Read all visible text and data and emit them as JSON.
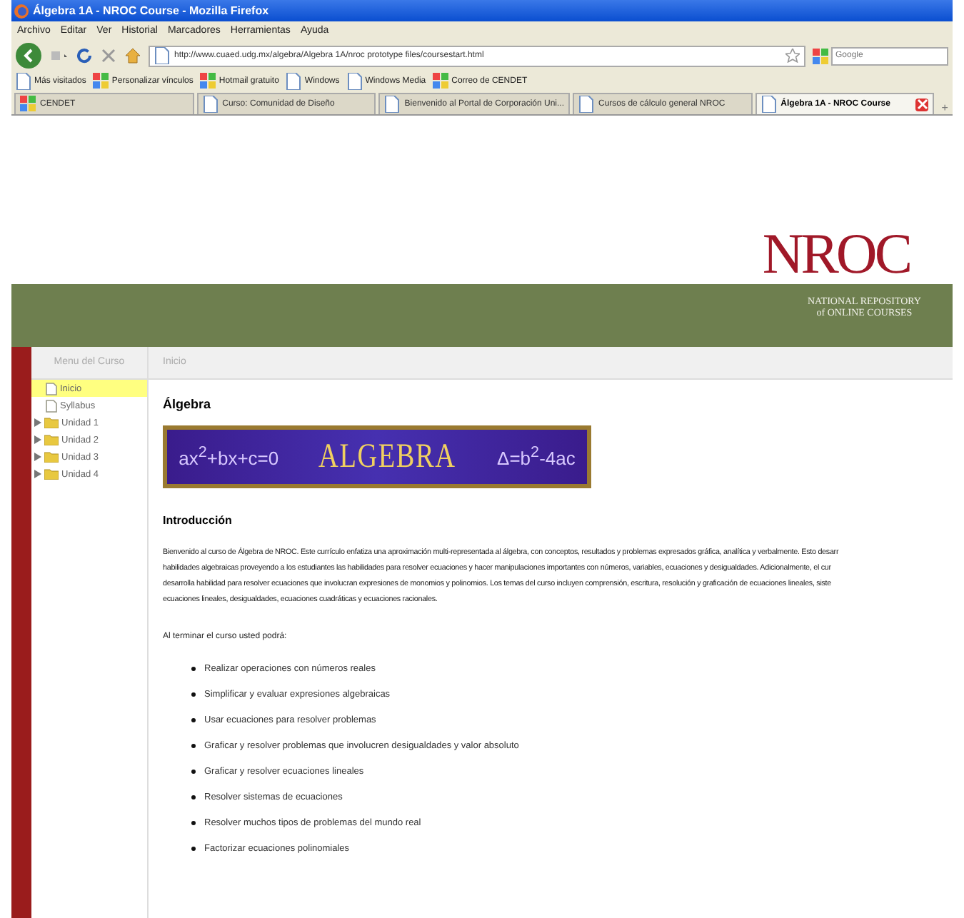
{
  "window": {
    "title": "Álgebra 1A - NROC Course - Mozilla Firefox"
  },
  "menu": [
    "Archivo",
    "Editar",
    "Ver",
    "Historial",
    "Marcadores",
    "Herramientas",
    "Ayuda"
  ],
  "address": {
    "value": "http://www.cuaed.udg.mx/algebra/Algebra 1A/nroc prototype files/coursestart.html"
  },
  "search": {
    "placeholder": "Google"
  },
  "bookmarks": [
    {
      "label": "Más visitados",
      "kind": "page"
    },
    {
      "label": "Personalizar vínculos",
      "kind": "site"
    },
    {
      "label": "Hotmail gratuito",
      "kind": "site"
    },
    {
      "label": "Windows",
      "kind": "page"
    },
    {
      "label": "Windows Media",
      "kind": "page"
    },
    {
      "label": "Correo de CENDET",
      "kind": "site"
    }
  ],
  "tabs": [
    {
      "label": "CENDET",
      "selected": false
    },
    {
      "label": "Curso: Comunidad de Diseño",
      "selected": false
    },
    {
      "label": "Bienvenido al Portal de Corporación Uni...",
      "selected": false
    },
    {
      "label": "Cursos de cálculo general NROC",
      "selected": false
    },
    {
      "label": "Álgebra 1A - NROC Course",
      "selected": true
    }
  ],
  "new_tab": "+",
  "logo": {
    "name": "NROC",
    "subtitle_1": "NATIONAL REPOSITORY",
    "subtitle_2": "of ONLINE COURSES"
  },
  "sidebar": {
    "title": "Menu del Curso",
    "items": [
      {
        "label": "Inicio",
        "kind": "page",
        "selected": true
      },
      {
        "label": "Syllabus",
        "kind": "page",
        "selected": false
      },
      {
        "label": "Unidad 1",
        "kind": "folder",
        "selected": false
      },
      {
        "label": "Unidad 2",
        "kind": "folder",
        "selected": false
      },
      {
        "label": "Unidad 3",
        "kind": "folder",
        "selected": false
      },
      {
        "label": "Unidad 4",
        "kind": "folder",
        "selected": false
      }
    ]
  },
  "breadcrumb": "Inicio",
  "heading": "Álgebra",
  "banner": {
    "formula_1": "ax$^{2}$+bx+c=0",
    "title": "ALGEBRA",
    "formula_2": "Δ=b$^{2}$-4ac"
  },
  "intro_heading": "Introducción",
  "intro_lines": [
    "Bienvenido al curso de Álgebra de NROC. Este currículo enfatiza una aproximación multi-representada al álgebra, con conceptos, resultados y problemas expresados gráfica, analítica y verbalmente. Esto desarr",
    "habilidades algebraicas proveyendo a los estudiantes las habilidades para resolver ecuaciones y hacer manipulaciones importantes con números, variables, ecuaciones y desigualdades. Adicionalmente, el cur",
    "desarrolla habilidad para resolver ecuaciones que involucran expresiones de monomios y polinomios. Los temas del curso incluyen comprensión, escritura, resolución y graficación de ecuaciones lineales, siste",
    "ecuaciones lineales, desigualdades, ecuaciones cuadráticas y ecuaciones racionales."
  ],
  "outcomes_intro": "Al terminar el curso usted podrá:",
  "outcomes": [
    "Realizar operaciones con números reales",
    "Simplificar y evaluar expresiones algebraicas",
    "Usar ecuaciones para resolver problemas",
    "Graficar y resolver problemas que involucren desigualdades y valor absoluto",
    "Graficar y resolver ecuaciones lineales",
    "Resolver sistemas de ecuaciones",
    "Resolver muchos tipos de problemas del mundo real",
    "Factorizar ecuaciones polinomiales"
  ]
}
